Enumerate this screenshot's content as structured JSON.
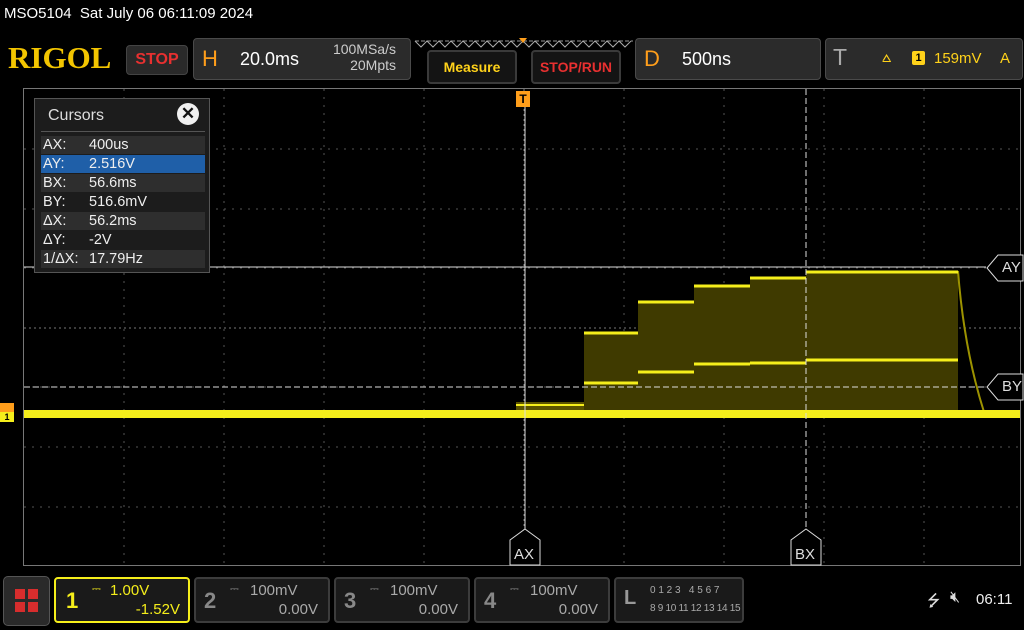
{
  "status": {
    "device": "MSO5104",
    "datetime": "Sat July 06 06:11:09 2024"
  },
  "brand": {
    "logo": "RIGOL",
    "run_state": "STOP"
  },
  "horizontal": {
    "tag": "H",
    "timebase": "20.0ms",
    "sample_rate": "100MSa/s",
    "memory_depth": "20Mpts"
  },
  "buttons": {
    "measure": "Measure",
    "stop_run": "STOP/RUN"
  },
  "delay": {
    "tag": "D",
    "value": "500ns"
  },
  "trigger": {
    "tag": "T",
    "channel": "1",
    "level": "159mV",
    "mode": "A"
  },
  "cursors": {
    "title": "Cursors",
    "rows": [
      {
        "key": "AX:",
        "value": "400us"
      },
      {
        "key": "AY:",
        "value": "2.516V"
      },
      {
        "key": "BX:",
        "value": "56.6ms"
      },
      {
        "key": "BY:",
        "value": "516.6mV"
      },
      {
        "key": "ΔX:",
        "value": "56.2ms"
      },
      {
        "key": "ΔY:",
        "value": "-2V"
      },
      {
        "key": "1/ΔX:",
        "value": "17.79Hz"
      }
    ],
    "markers": {
      "ax": "AX",
      "bx": "BX",
      "ay": "AY",
      "by": "BY"
    }
  },
  "channels": [
    {
      "num": "1",
      "scale": "1.00V",
      "offset": "-1.52V",
      "active": true
    },
    {
      "num": "2",
      "scale": "100mV",
      "offset": "0.00V",
      "active": false
    },
    {
      "num": "3",
      "scale": "100mV",
      "offset": "0.00V",
      "active": false
    },
    {
      "num": "4",
      "scale": "100mV",
      "offset": "0.00V",
      "active": false
    }
  ],
  "logic": {
    "tag": "L",
    "row1": "0 1 2 3   4 5 6 7",
    "row2": "8 9 10 11 12 13 14 15"
  },
  "system": {
    "time": "06:11"
  },
  "colors": {
    "ch1": "#f5ee1b",
    "accent": "#ff9e1b",
    "stop": "#e83030"
  }
}
